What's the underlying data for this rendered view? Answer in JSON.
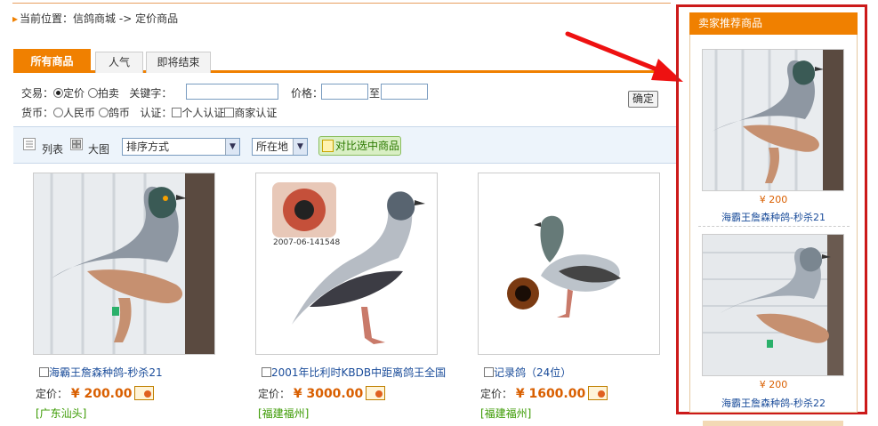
{
  "breadcrumb": {
    "label": "当前位置：",
    "home": "信鸽商城",
    "sep": "->",
    "current": "定价商品"
  },
  "tabs": [
    {
      "label": "所有商品",
      "active": true
    },
    {
      "label": "人气",
      "active": false
    },
    {
      "label": "即将结束",
      "active": false
    }
  ],
  "filters": {
    "trade_label": "交易：",
    "trade_fixed": "定价",
    "trade_auction": "拍卖",
    "keyword_label": "关键字：",
    "keyword_value": "",
    "price_label": "价格：",
    "price_to": "至",
    "price_from_value": "",
    "price_to_value": "",
    "confirm": "确定",
    "currency_label": "货币：",
    "currency_rmb": "人民币",
    "currency_pigeon": "鸽币",
    "cert_label": "认证：",
    "cert_personal": "个人认证",
    "cert_merchant": "商家认证"
  },
  "toolbar": {
    "list_view": "列表",
    "grid_view": "大图",
    "sort_select": "排序方式",
    "location_select": "所在地",
    "compare_button": "对比选中商品"
  },
  "products": [
    {
      "name": "海霸王詹森种鸽-秒杀21",
      "price_label": "定价：",
      "price": "¥ 200.00",
      "location": "[广东汕头]"
    },
    {
      "name": "2001年比利时KBDB中距离鸽王全国",
      "price_label": "定价：",
      "price": "¥ 3000.00",
      "location": "[福建福州]",
      "photo_caption": "2007-06-141548"
    },
    {
      "name": "记录鸽（24位）",
      "price_label": "定价：",
      "price": "¥ 1600.00",
      "location": "[福建福州]"
    }
  ],
  "sidebar": {
    "title": "卖家推荐商品",
    "items": [
      {
        "price": "¥ 200",
        "name": "海霸王詹森种鸽-秒杀21"
      },
      {
        "price": "¥ 200",
        "name": "海霸王詹森种鸽-秒杀22"
      }
    ]
  },
  "colors": {
    "accent": "#f08000",
    "annotation": "#cc1a1a",
    "link": "#1a4c9a",
    "price": "#d95f00",
    "location": "#3a9a00"
  }
}
